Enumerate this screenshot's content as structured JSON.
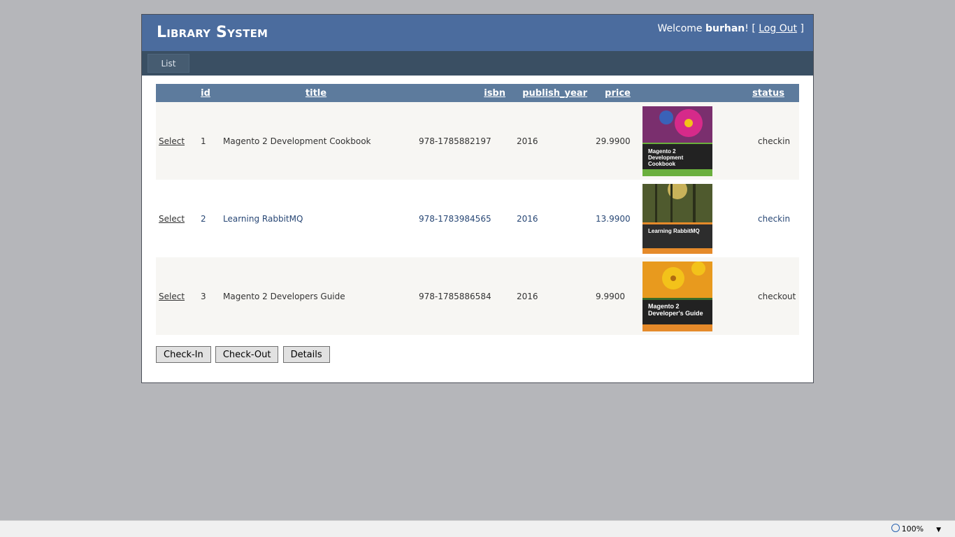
{
  "header": {
    "site_title": "Library System",
    "welcome_prefix": "Welcome ",
    "username": "burhan",
    "welcome_suffix": "! [ ",
    "logout_label": "Log Out",
    "close_bracket": " ]"
  },
  "menu": {
    "items": [
      {
        "label": "List"
      }
    ]
  },
  "grid": {
    "columns": [
      "",
      "id",
      "title",
      "isbn",
      "publish_year",
      "price",
      "",
      "status"
    ],
    "select_label": "Select",
    "rows": [
      {
        "id": "1",
        "title": "Magento 2 Development Cookbook",
        "isbn": "978-1785882197",
        "publish_year": "2016",
        "price": "29.9900",
        "cover": {
          "title": "Magento 2 Development Cookbook",
          "colors": {
            "top": "#7a2f6e",
            "accent": "#d62a8a",
            "band": "#222222",
            "strip": "#6aaf3d"
          }
        },
        "status": "checkin"
      },
      {
        "id": "2",
        "title": "Learning RabbitMQ",
        "isbn": "978-1783984565",
        "publish_year": "2016",
        "price": "13.9900",
        "cover": {
          "title": "Learning RabbitMQ",
          "colors": {
            "top": "#4f5a2e",
            "accent": "#c8b25a",
            "band": "#2d2d2d",
            "strip": "#e58a2a"
          }
        },
        "status": "checkin"
      },
      {
        "id": "3",
        "title": "Magento 2 Developers Guide",
        "isbn": "978-1785886584",
        "publish_year": "2016",
        "price": "9.9900",
        "cover": {
          "title": "Magento 2 Developer's Guide",
          "colors": {
            "top": "#e89a1e",
            "accent": "#f3c21a",
            "band": "#222222",
            "strip": "#e58a2a"
          }
        },
        "status": "checkout"
      }
    ]
  },
  "actions": {
    "checkin_label": "Check-In",
    "checkout_label": "Check-Out",
    "details_label": "Details"
  },
  "statusbar": {
    "zoom": "100%"
  },
  "colors": {
    "header_bg": "#4b6c9e",
    "menu_bg": "#3a4f63",
    "grid_header_bg": "#5d7b9d",
    "row_alt_text": "#284775"
  }
}
